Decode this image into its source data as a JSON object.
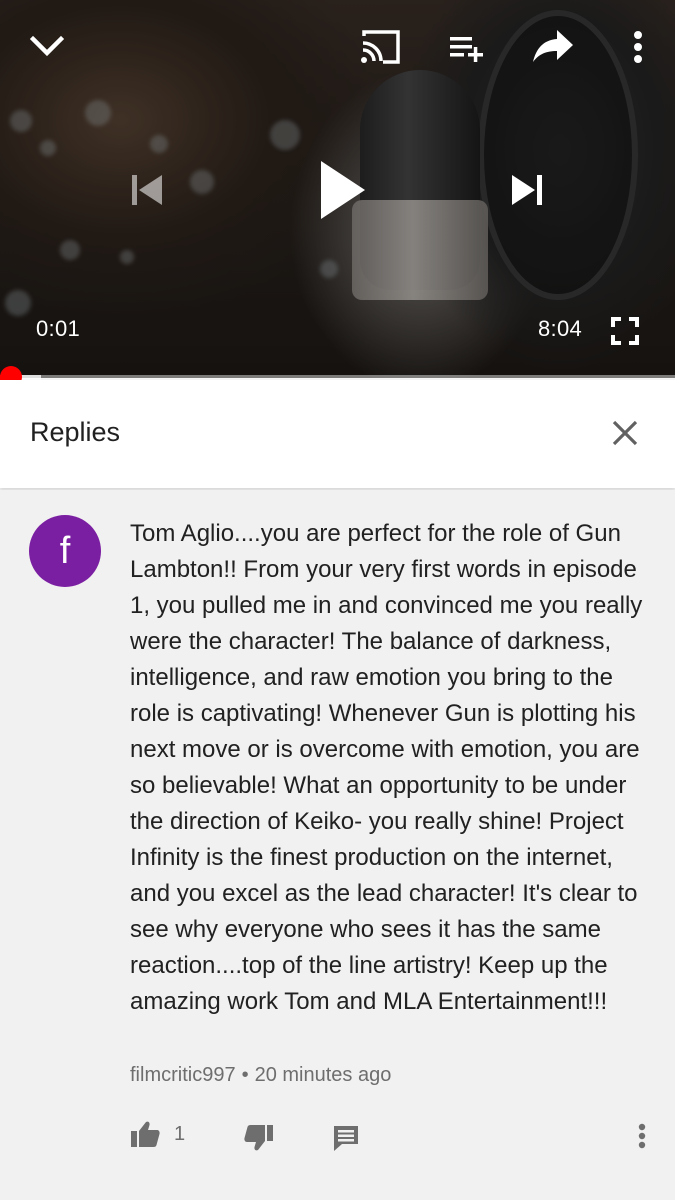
{
  "player": {
    "current_time": "0:01",
    "duration": "8:04",
    "progress_fraction": 0.002,
    "buffered_fraction": 0.06,
    "icons": {
      "collapse": "chevron-down-icon",
      "cast": "cast-icon",
      "add_to_playlist": "playlist-add-icon",
      "share": "share-icon",
      "more": "more-vert-icon",
      "previous": "skip-previous-icon",
      "play": "play-icon",
      "next": "skip-next-icon",
      "fullscreen": "fullscreen-icon"
    }
  },
  "replies_panel": {
    "title": "Replies",
    "close_icon": "close-icon"
  },
  "comment": {
    "avatar_letter": "f",
    "avatar_color": "#7b1fa2",
    "text": "Tom Aglio....you are perfect for the role of Gun Lambton!! From your very first words in episode 1, you pulled me in and convinced me you really were the character! The balance of darkness,  intelligence, and raw emotion you bring to the role is captivating! Whenever Gun is plotting his next move or is overcome with emotion, you are so believable! What an opportunity to be under the direction of Keiko- you really shine! Project Infinity is the finest production on the internet, and you excel as the lead character! It's clear to see why everyone who sees it has the same reaction....top of the line artistry! Keep up the amazing work Tom and MLA Entertainment!!!",
    "author": "filmcritic997",
    "separator": "•",
    "timestamp": "20 minutes ago",
    "like_count": "1"
  },
  "colors": {
    "progress": "#ff0000",
    "text_primary": "#212121",
    "text_secondary": "#6e6e6e",
    "background": "#f1f1f1"
  }
}
